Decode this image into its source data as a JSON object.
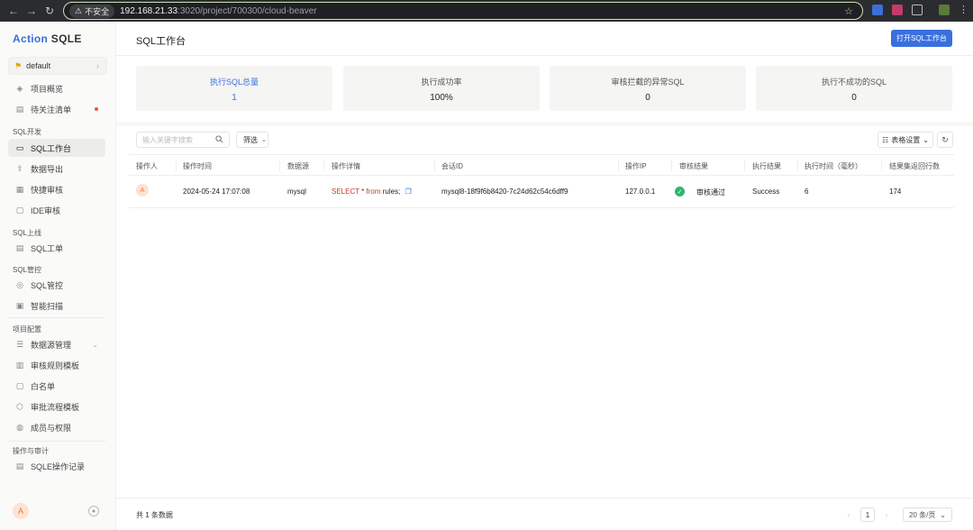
{
  "browser": {
    "insecure_label": "不安全",
    "url_host": "192.168.21.33",
    "url_path": ":3020/project/700300/cloud-beaver"
  },
  "brand": {
    "part1": "Action",
    "part2": "SQLE"
  },
  "project": {
    "name": "default"
  },
  "sidebar": {
    "top_items": [
      {
        "label": "项目概览",
        "icon": "dashboard-icon"
      },
      {
        "label": "待关注清单",
        "icon": "list-icon"
      }
    ],
    "groups": [
      {
        "title": "SQL开发",
        "items": [
          {
            "label": "SQL工作台",
            "icon": "monitor-icon",
            "active": true
          },
          {
            "label": "数据导出",
            "icon": "export-icon"
          },
          {
            "label": "快捷审核",
            "icon": "quick-audit-icon"
          },
          {
            "label": "IDE审核",
            "icon": "ide-icon"
          }
        ]
      },
      {
        "title": "SQL上线",
        "items": [
          {
            "label": "SQL工单",
            "icon": "ticket-icon"
          }
        ]
      },
      {
        "title": "SQL管控",
        "items": [
          {
            "label": "SQL管控",
            "icon": "control-icon"
          },
          {
            "label": "智能扫描",
            "icon": "scan-icon"
          }
        ]
      },
      {
        "title": "项目配置",
        "items": [
          {
            "label": "数据源管理",
            "icon": "database-icon"
          },
          {
            "label": "审核规则模板",
            "icon": "rules-icon"
          },
          {
            "label": "白名单",
            "icon": "whitelist-icon"
          },
          {
            "label": "审批流程模板",
            "icon": "workflow-icon"
          },
          {
            "label": "成员与权限",
            "icon": "members-icon"
          }
        ]
      },
      {
        "title": "操作与审计",
        "items": [
          {
            "label": "SQLE操作记录",
            "icon": "log-icon"
          }
        ]
      }
    ],
    "user_avatar": "A"
  },
  "header": {
    "title": "SQL工作台",
    "open_button": "打开SQL工作台"
  },
  "stats": [
    {
      "label": "执行SQL总量",
      "value": "1"
    },
    {
      "label": "执行成功率",
      "value": "100%"
    },
    {
      "label": "审核拦截的异常SQL",
      "value": "0"
    },
    {
      "label": "执行不成功的SQL",
      "value": "0"
    }
  ],
  "toolbar": {
    "search_placeholder": "输入关键字搜索",
    "filter_label": "筛选",
    "table_settings_label": "表格设置"
  },
  "table": {
    "columns": [
      "操作人",
      "操作时间",
      "数据源",
      "操作详情",
      "会话ID",
      "操作IP",
      "审核结果",
      "执行结果",
      "执行时间（毫秒）",
      "结果集返回行数"
    ],
    "rows": [
      {
        "operator": "A",
        "time": "2024-05-24 17:07:08",
        "datasource": "mysql",
        "sql": {
          "kw1": "SELECT",
          "star": " * ",
          "kw2": "from",
          "rest": " rules;"
        },
        "session_id": "mysql8-18f9f6b8420-7c24d62c54c6dff9",
        "ip": "127.0.0.1",
        "audit_result": "审核通过",
        "exec_result": "Success",
        "exec_time": "6",
        "rows_returned": "174"
      }
    ]
  },
  "footer": {
    "total": "共 1 条数据",
    "page": "1",
    "page_size": "20 条/页"
  },
  "colors": {
    "accent": "#3a6fe0",
    "success": "#2bb673",
    "sql_keyword": "#c0392b"
  }
}
